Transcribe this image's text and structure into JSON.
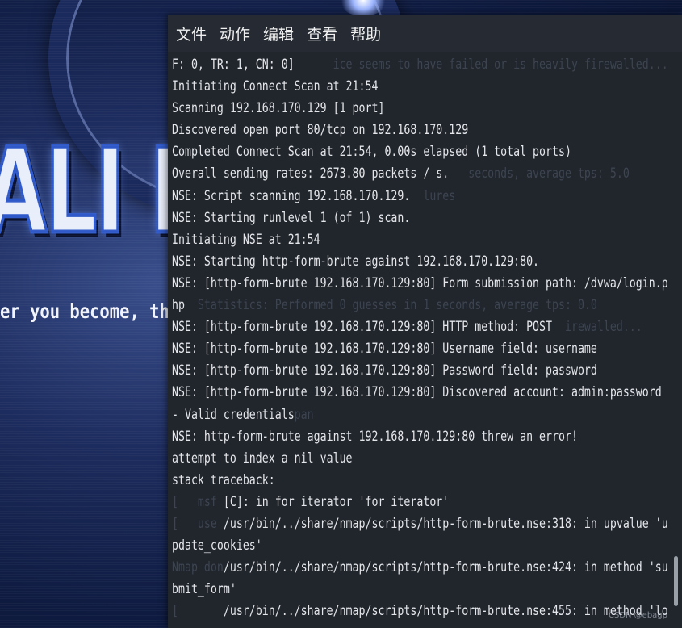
{
  "menu": [
    "文件",
    "动作",
    "编辑",
    "查看",
    "帮助"
  ],
  "wallpaper": {
    "logo_text": "ALI L",
    "slogan": "er you become, the"
  },
  "terminal": {
    "lines": [
      "F: 0, TR: 1, CN: 0]",
      "Initiating Connect Scan at 21:54",
      "Scanning 192.168.170.129 [1 port]",
      "Discovered open port 80/tcp on 192.168.170.129",
      "Completed Connect Scan at 21:54, 0.00s elapsed (1 total ports)",
      "Overall sending rates: 2673.80 packets / s.",
      "NSE: Script scanning 192.168.170.129.",
      "NSE: Starting runlevel 1 (of 1) scan.",
      "Initiating NSE at 21:54",
      "NSE: Starting http-form-brute against 192.168.170.129:80.",
      "NSE: [http-form-brute 192.168.170.129:80] Form submission path: /dvwa/login.p",
      "hp",
      "NSE: [http-form-brute 192.168.170.129:80] HTTP method: POST",
      "NSE: [http-form-brute 192.168.170.129:80] Username field: username",
      "NSE: [http-form-brute 192.168.170.129:80] Password field: password",
      "NSE: [http-form-brute 192.168.170.129:80] Discovered account: admin:password",
      "- Valid credentials",
      "NSE: http-form-brute against 192.168.170.129:80 threw an error!",
      "attempt to index a nil value",
      "stack traceback:",
      "        [C]: in for iterator 'for iterator'",
      "        /usr/bin/../share/nmap/scripts/http-form-brute.nse:318: in upvalue 'u",
      "pdate_cookies'",
      "        /usr/bin/../share/nmap/scripts/http-form-brute.nse:424: in method 'su",
      "bmit_form'",
      "        /usr/bin/../share/nmap/scripts/http-form-brute.nse:455: in method 'lo"
    ],
    "ghost_lines": [
      "                         ice seems to have failed or is heavily firewalled...",
      "",
      "",
      "",
      "",
      "                                              seconds, average tps: 5.0",
      "                                       lures",
      "",
      "",
      "",
      "",
      "    Statistics: Performed 0 guesses in 1 seconds, average tps: 0.0",
      "                                                             irewalled...",
      "",
      "",
      "",
      "                   pan",
      "",
      "",
      "",
      "[   msf",
      "[   use",
      "",
      "Nmap don",
      "",
      "[   "
    ],
    "watermark": "CSDN @ebagp"
  }
}
